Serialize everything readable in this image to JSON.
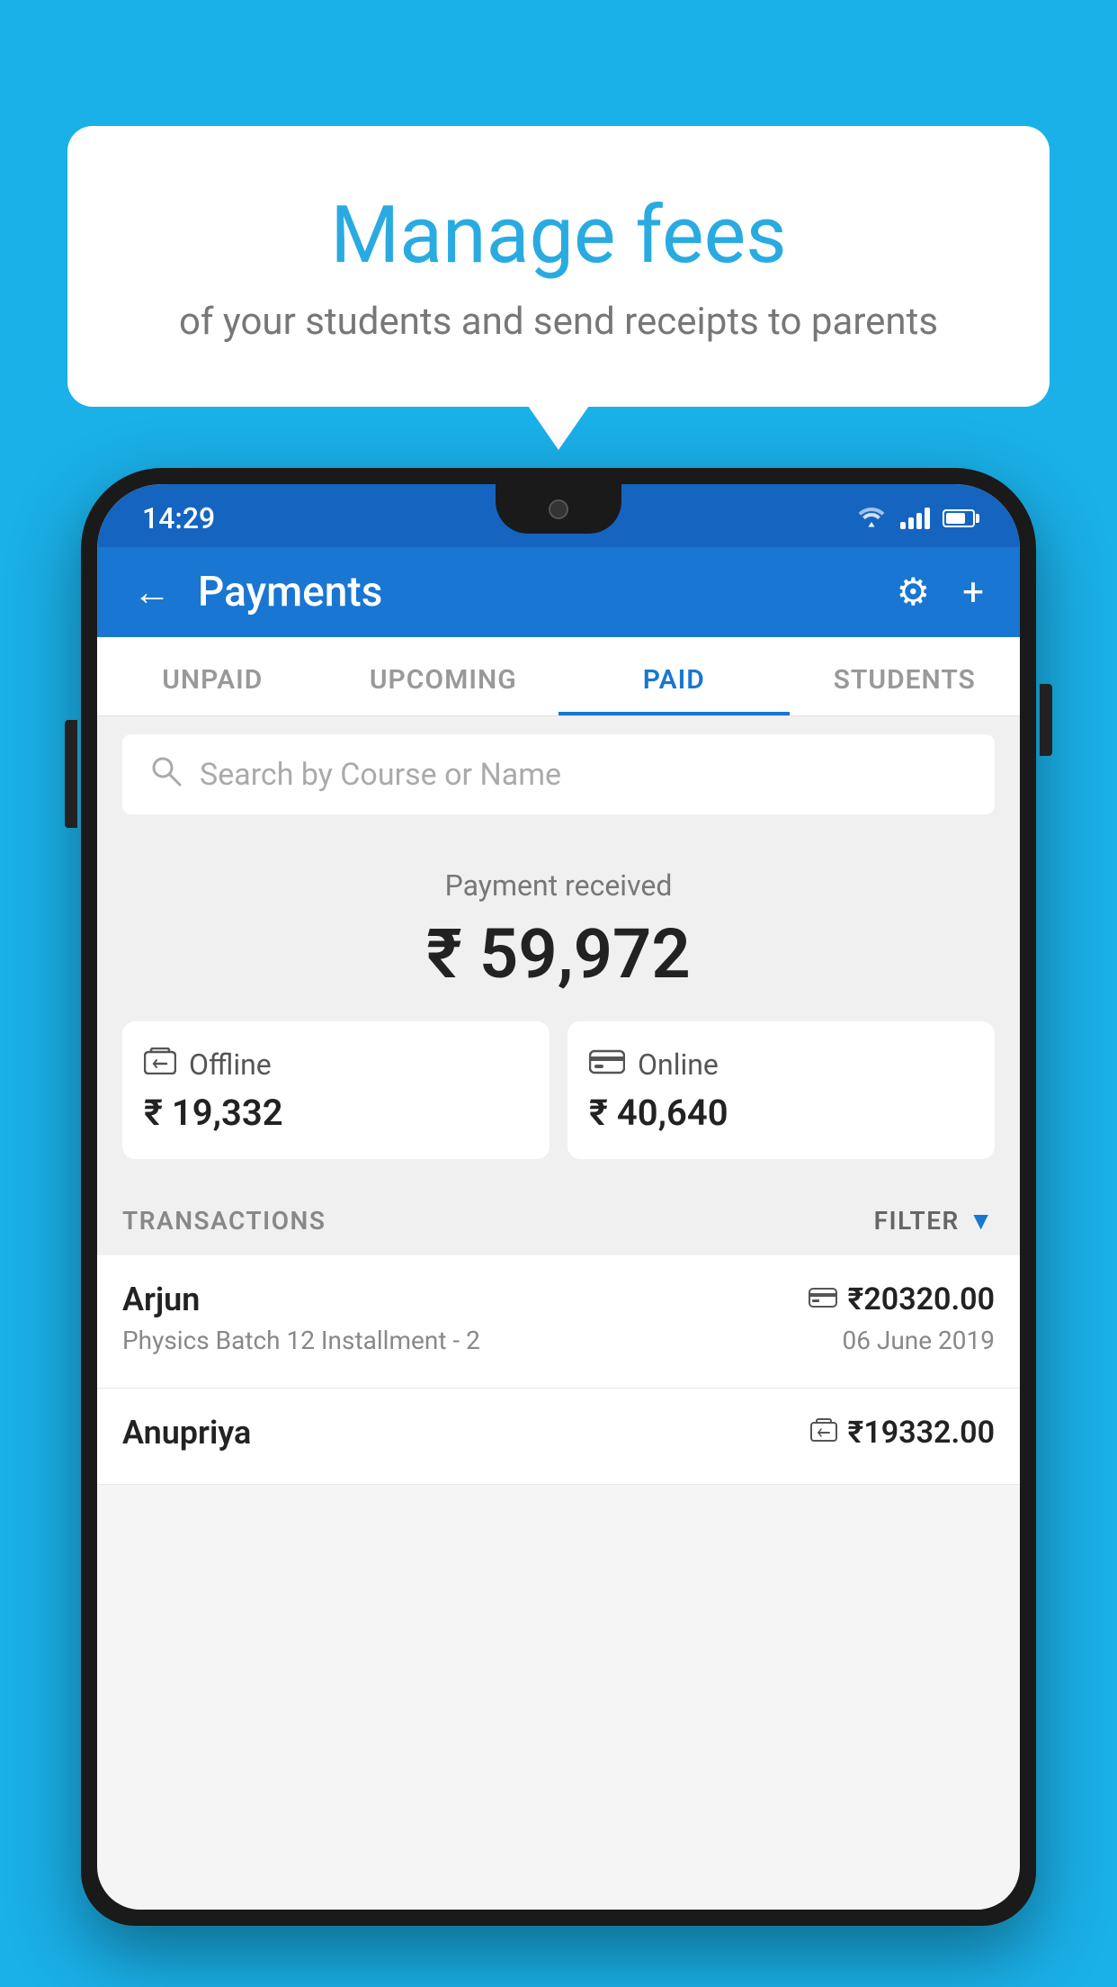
{
  "background_color": "#1ab0e8",
  "bubble": {
    "title": "Manage fees",
    "subtitle": "of your students and send receipts to parents"
  },
  "status_bar": {
    "time": "14:29"
  },
  "header": {
    "title": "Payments",
    "back_label": "←",
    "gear_label": "⚙",
    "plus_label": "+"
  },
  "tabs": [
    {
      "label": "UNPAID",
      "active": false
    },
    {
      "label": "UPCOMING",
      "active": false
    },
    {
      "label": "PAID",
      "active": true
    },
    {
      "label": "STUDENTS",
      "active": false
    }
  ],
  "search": {
    "placeholder": "Search by Course or Name"
  },
  "payment_summary": {
    "label": "Payment received",
    "amount": "₹ 59,972",
    "offline": {
      "type": "Offline",
      "amount": "₹ 19,332"
    },
    "online": {
      "type": "Online",
      "amount": "₹ 40,640"
    }
  },
  "transactions": {
    "label": "TRANSACTIONS",
    "filter_label": "FILTER",
    "items": [
      {
        "name": "Arjun",
        "course": "Physics Batch 12 Installment - 2",
        "amount": "₹20320.00",
        "date": "06 June 2019",
        "payment_type": "online"
      },
      {
        "name": "Anupriya",
        "course": "",
        "amount": "₹19332.00",
        "date": "",
        "payment_type": "offline"
      }
    ]
  }
}
